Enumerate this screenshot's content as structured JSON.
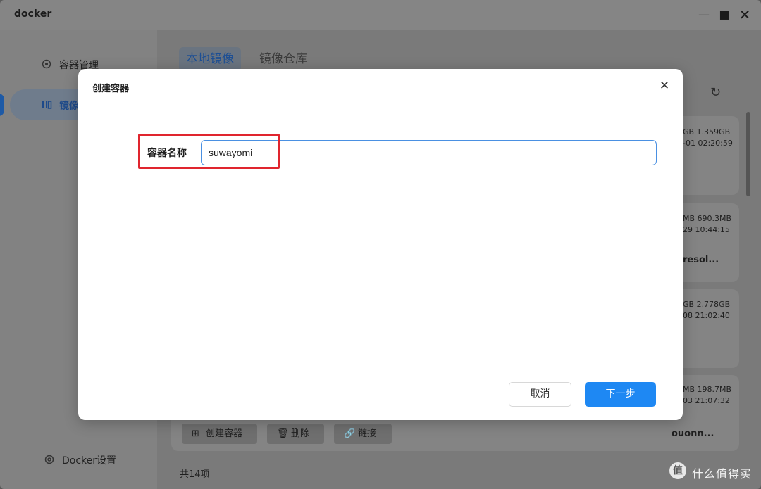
{
  "window": {
    "title": "docker",
    "controls": {
      "minimize": "—",
      "maximize": "■",
      "close": "✕"
    }
  },
  "sidebar": {
    "items": [
      {
        "label": "容器管理",
        "icon": "settings-gear-icon"
      },
      {
        "label": "镜像",
        "icon": "image-layers-icon",
        "active": true
      },
      {
        "label": "Docker设置",
        "icon": "docker-settings-icon"
      }
    ]
  },
  "main": {
    "tabs": [
      {
        "label": "本地镜像",
        "active": true
      },
      {
        "label": "镜像仓库",
        "active": false
      }
    ],
    "refresh_icon": "↻",
    "cards": [
      {
        "meta1": "GB 1.359GB",
        "meta2": "-01 02:20:59",
        "name": ""
      },
      {
        "meta1": "MB 690.3MB",
        "meta2": "29 10:44:15",
        "name": "resol..."
      },
      {
        "meta1": "GB 2.778GB",
        "meta2": "08 21:02:40",
        "name": ""
      },
      {
        "meta1": "MB 198.7MB",
        "meta2": "03 21:07:32",
        "name": ""
      }
    ],
    "actions": {
      "create": "创建容器",
      "delete": "删除",
      "link": "链接",
      "item_name": "ouonn..."
    },
    "footer_count": "共14项"
  },
  "modal": {
    "title": "创建容器",
    "close_icon": "✕",
    "field_label": "容器名称",
    "container_name_value": "suwayomi",
    "cancel_label": "取消",
    "next_label": "下一步"
  },
  "watermark": {
    "circle": "值",
    "text": "什么值得买"
  },
  "colors": {
    "primary": "#1e88f3",
    "highlight": "#e0252e"
  }
}
